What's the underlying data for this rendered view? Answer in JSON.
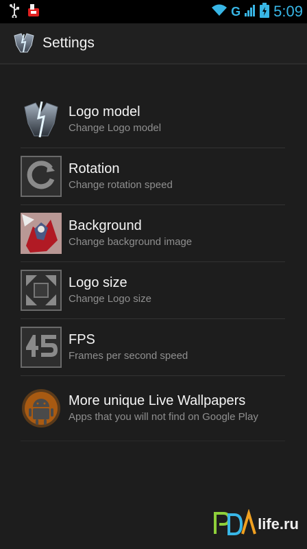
{
  "status_bar": {
    "time": "5:09",
    "network": "G",
    "icons": [
      "usb-icon",
      "notification-app-icon",
      "wifi-icon",
      "signal-icon",
      "battery-icon"
    ]
  },
  "action_bar": {
    "title": "Settings",
    "icon": "transformers-logo-icon"
  },
  "settings": [
    {
      "title": "Logo model",
      "subtitle": "Change Logo model",
      "icon": "logo-model-icon"
    },
    {
      "title": "Rotation",
      "subtitle": "Change rotation speed",
      "icon": "rotation-icon"
    },
    {
      "title": "Background",
      "subtitle": "Change background image",
      "icon": "background-image-icon"
    },
    {
      "title": "Logo size",
      "subtitle": "Change Logo size",
      "icon": "logo-size-icon"
    },
    {
      "title": "FPS",
      "subtitle": "Frames per second speed",
      "icon": "fps-icon"
    },
    {
      "title": "More unique Live Wallpapers",
      "subtitle": "Apps that you will not find on Google Play",
      "icon": "android-wallpapers-icon"
    }
  ],
  "watermark": {
    "text": "life.ru"
  },
  "colors": {
    "accent": "#38b6e6",
    "background": "#1d1d1d",
    "subtitle": "#8f8f8f"
  }
}
